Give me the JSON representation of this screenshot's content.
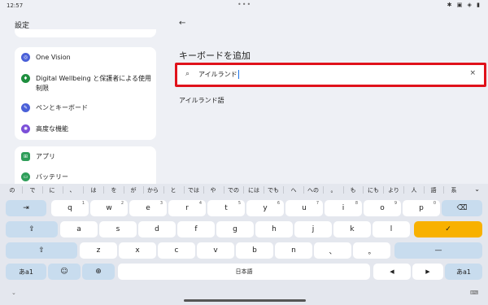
{
  "status": {
    "time": "12:57",
    "dots": "•••",
    "icons": "✱ ▣ ◈ ▮"
  },
  "settings": {
    "title": "設定",
    "items": [
      {
        "label": "One Vision",
        "icon": "vision-icon",
        "glyph": "◎"
      },
      {
        "label": "Digital Wellbeing と保護者による使用",
        "label2": "制限",
        "icon": "wellbeing-icon",
        "glyph": "♦"
      },
      {
        "label": "ペンとキーボード",
        "icon": "pen-icon",
        "glyph": "✎"
      },
      {
        "label": "高度な機能",
        "icon": "advanced-features-icon",
        "glyph": "✺"
      },
      {
        "label": "アプリ",
        "icon": "apps-icon",
        "glyph": "⊞"
      },
      {
        "label": "バッテリー",
        "icon": "battery-icon",
        "glyph": "▭"
      }
    ]
  },
  "detail": {
    "back": "←",
    "title": "キーボードを追加",
    "search_value": "アイルランド",
    "search_icon": "⌕",
    "clear_icon": "×",
    "result": "アイルランド語"
  },
  "keyboard": {
    "candidates": [
      "の",
      "で",
      "に",
      "、",
      "は",
      "を",
      "が",
      "から",
      "と",
      "では",
      "や",
      "での",
      "には",
      "でも",
      "へ",
      "への",
      "。",
      "も",
      "にも",
      "より",
      "人",
      "語",
      "系"
    ],
    "expand": "⌄",
    "rows": {
      "r1": [
        "q",
        "w",
        "e",
        "r",
        "t",
        "y",
        "u",
        "i",
        "o",
        "p"
      ],
      "r1_hints": [
        "1",
        "2",
        "3",
        "4",
        "5",
        "6",
        "7",
        "8",
        "9",
        "0"
      ],
      "r2": [
        "a",
        "s",
        "d",
        "f",
        "g",
        "h",
        "j",
        "k",
        "l"
      ],
      "r3": [
        "z",
        "x",
        "c",
        "v",
        "b",
        "n",
        "、",
        "。"
      ]
    },
    "tab": "⇥",
    "backspace": "⌫",
    "caps": "⇪",
    "enter": "✓",
    "shift": "⇧",
    "dash": "—",
    "lang_left": "あa1",
    "emoji": "☺",
    "globe": "⊕",
    "space": "日本語",
    "left_arrow": "◀",
    "right_arrow": "▶",
    "lang_right": "あa1"
  },
  "navbar": {
    "left": "⌄",
    "right": "⌨"
  },
  "colors": {
    "highlight": "#e0121b",
    "enter_key": "#f8b100",
    "func_key": "#c8dcee",
    "icon_bg": "#4a60d8"
  }
}
